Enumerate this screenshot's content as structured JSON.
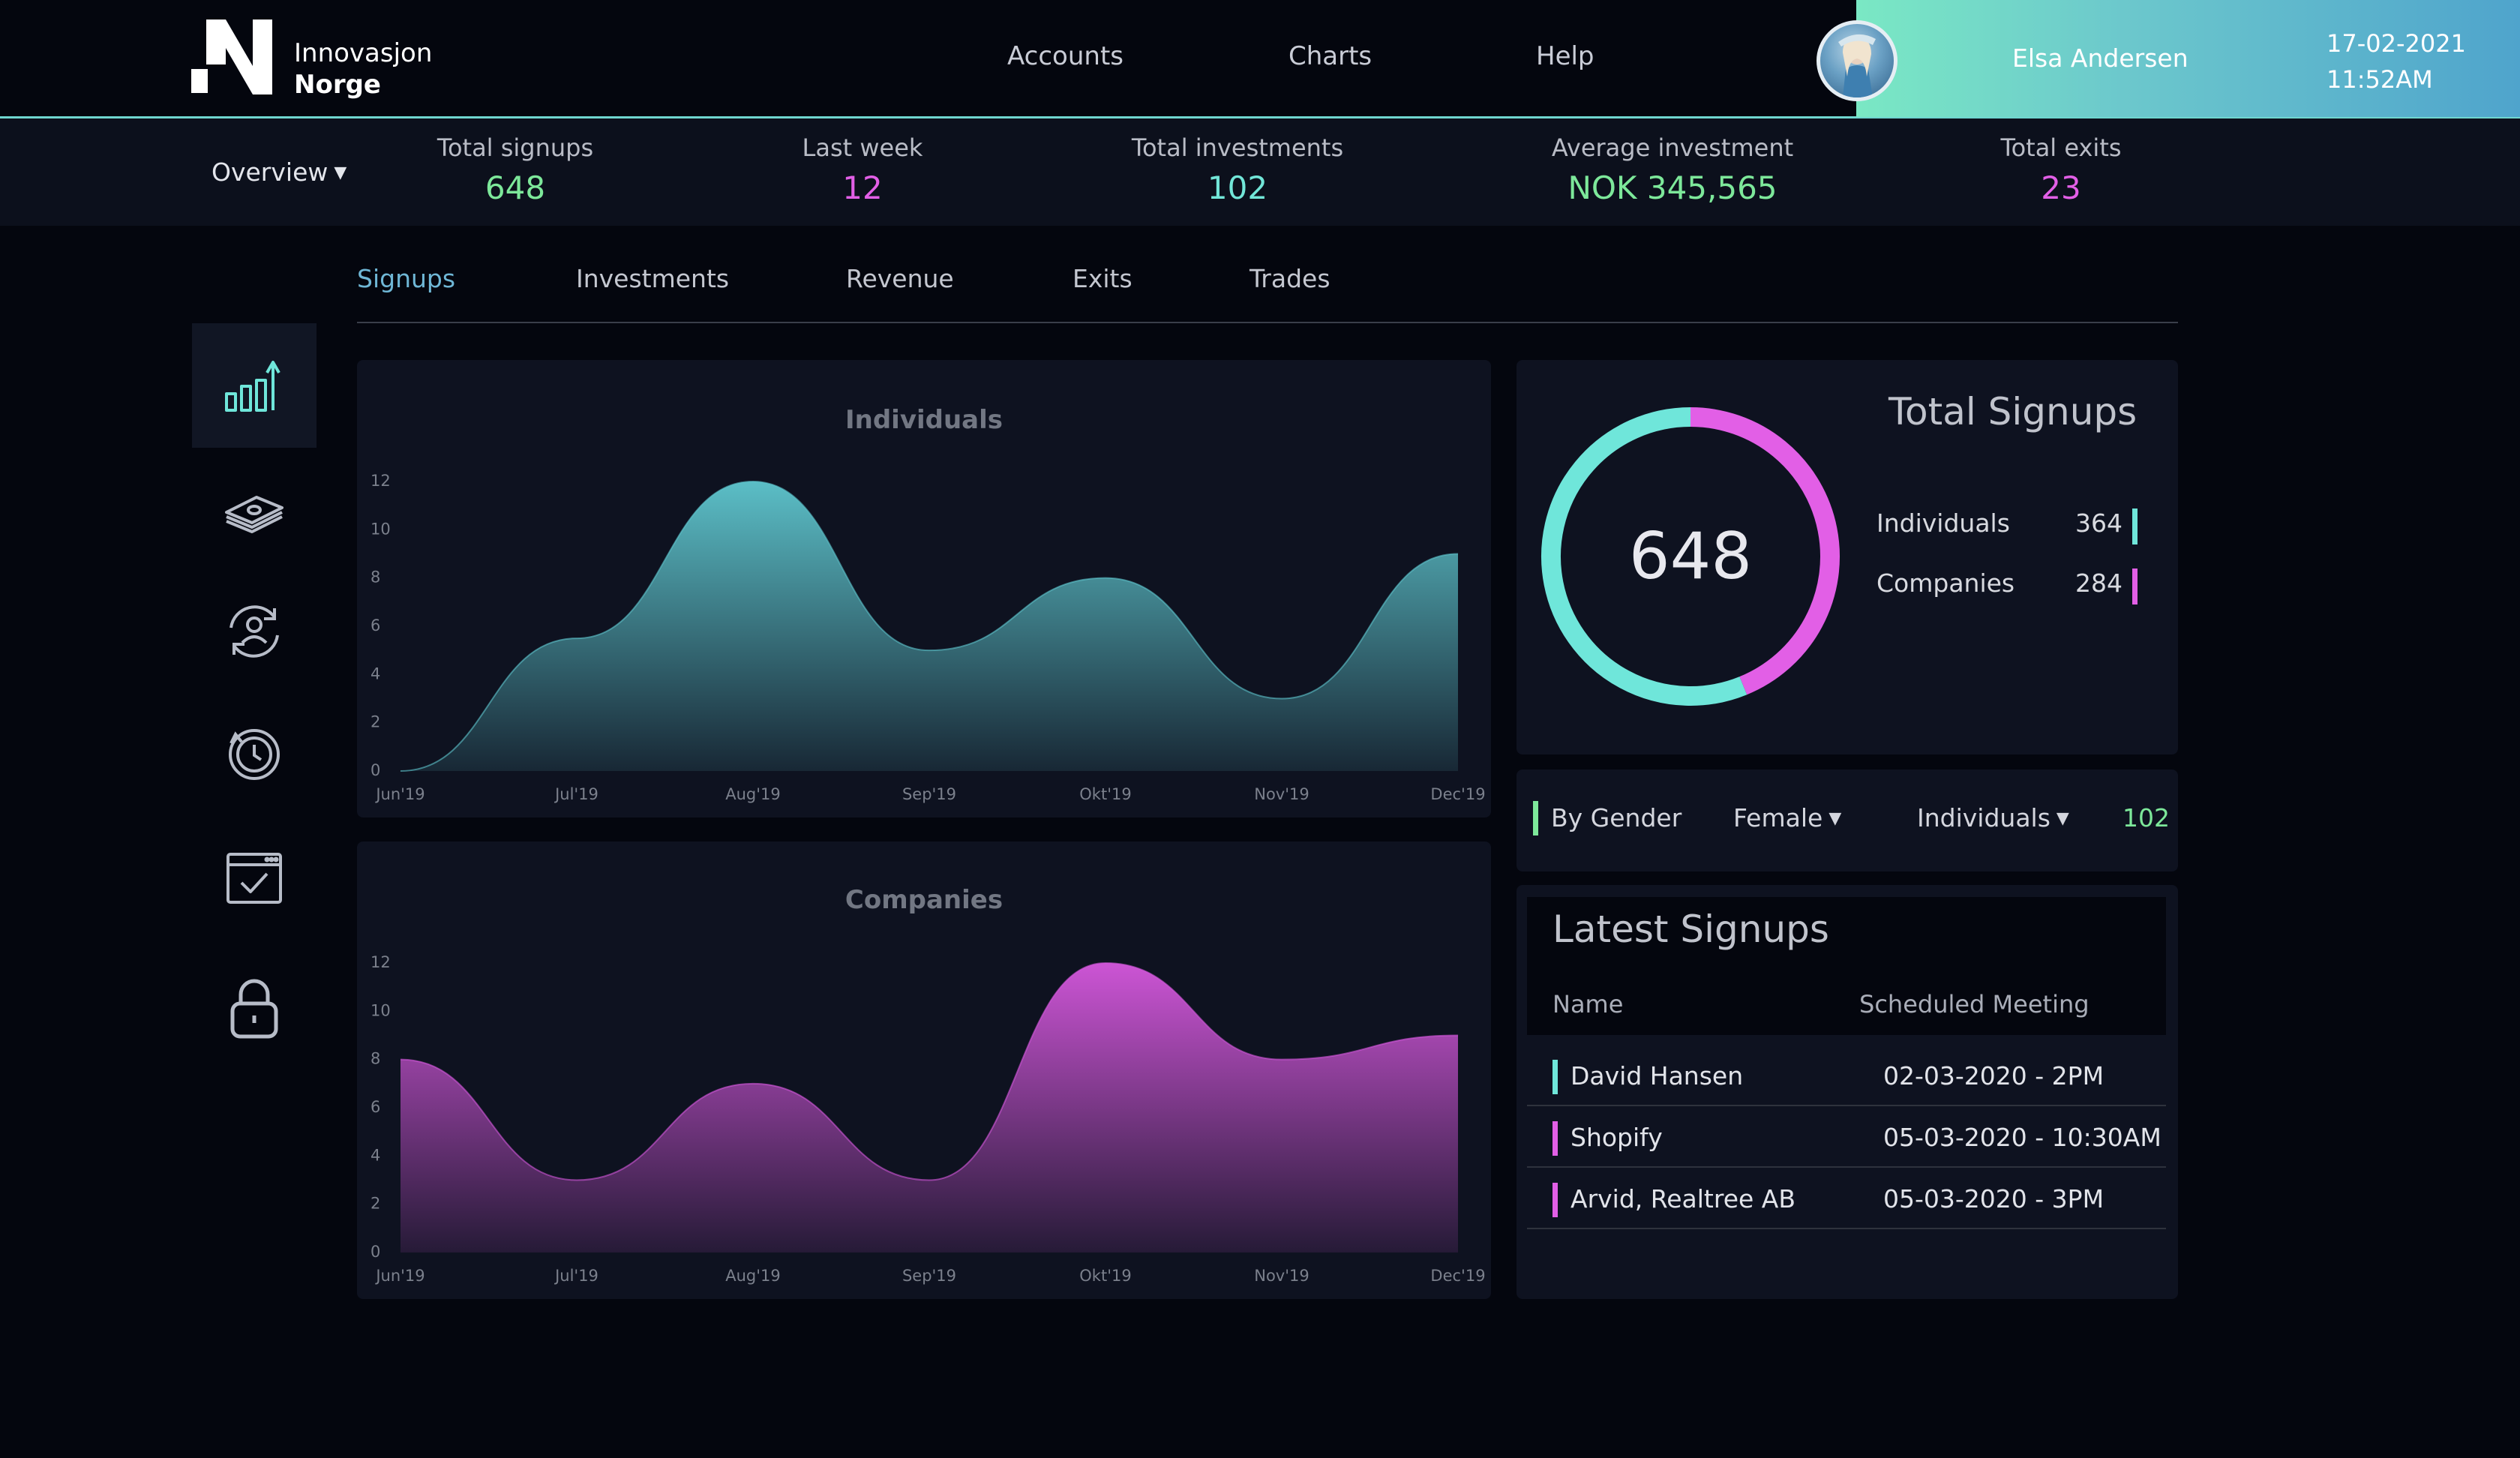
{
  "brand": {
    "line1": "Innovasjon",
    "line2": "Norge"
  },
  "nav": [
    {
      "label": "Accounts"
    },
    {
      "label": "Charts"
    },
    {
      "label": "Help"
    }
  ],
  "user": {
    "name": "Elsa Andersen",
    "date": "17-02-2021",
    "time": "11:52AM"
  },
  "stats": {
    "view_label": "Overview",
    "items": [
      {
        "label": "Total signups",
        "value": "648",
        "color": "#7de89a"
      },
      {
        "label": "Last week",
        "value": "12",
        "color": "#e25fe6"
      },
      {
        "label": "Total investments",
        "value": "102",
        "color": "#72e6d8"
      },
      {
        "label": "Average investment",
        "currency": "NOK",
        "value": "345,565",
        "color": "#7de89a"
      },
      {
        "label": "Total exits",
        "value": "23",
        "color": "#e25fe6"
      }
    ]
  },
  "tabs": [
    {
      "label": "Signups",
      "active": true
    },
    {
      "label": "Investments"
    },
    {
      "label": "Revenue"
    },
    {
      "label": "Exits"
    },
    {
      "label": "Trades"
    }
  ],
  "sidebar": [
    {
      "icon": "bar-chart-growth-icon",
      "active": true
    },
    {
      "icon": "money-stack-icon"
    },
    {
      "icon": "user-exchange-icon"
    },
    {
      "icon": "clock-history-icon"
    },
    {
      "icon": "calendar-check-icon"
    },
    {
      "icon": "lock-icon"
    }
  ],
  "chart_data": [
    {
      "type": "area",
      "title": "Individuals",
      "categories": [
        "Jun'19",
        "Jul'19",
        "Aug'19",
        "Sep'19",
        "Okt'19",
        "Nov'19",
        "Dec'19"
      ],
      "values": [
        0,
        5.5,
        12,
        5,
        8,
        3,
        9
      ],
      "ylim": [
        0,
        12
      ],
      "yticks": [
        0,
        2,
        4,
        6,
        8,
        10,
        12
      ],
      "color": "#5fc7cf"
    },
    {
      "type": "area",
      "title": "Companies",
      "categories": [
        "Jun'19",
        "Jul'19",
        "Aug'19",
        "Sep'19",
        "Okt'19",
        "Nov'19",
        "Dec'19"
      ],
      "values": [
        8,
        3,
        7,
        3,
        12,
        8,
        9
      ],
      "ylim": [
        0,
        12
      ],
      "yticks": [
        0,
        2,
        4,
        6,
        8,
        10,
        12
      ],
      "color": "#d658de"
    },
    {
      "type": "pie",
      "title": "Total Signups",
      "total": "648",
      "series": [
        {
          "name": "Individuals",
          "value": 364,
          "color": "#6fe6da"
        },
        {
          "name": "Companies",
          "value": 284,
          "color": "#e25fe6"
        }
      ]
    }
  ],
  "filter": {
    "label": "By Gender",
    "gender": "Female",
    "type": "Individuals",
    "value": "102"
  },
  "latest": {
    "title": "Latest Signups",
    "col_name": "Name",
    "col_meeting": "Scheduled Meeting",
    "rows": [
      {
        "name": "David Hansen",
        "meeting": "02-03-2020 - 2PM",
        "color": "#6fe6da"
      },
      {
        "name": "Shopify",
        "meeting": "05-03-2020 - 10:30AM",
        "color": "#e25fe6"
      },
      {
        "name": "Arvid, Realtree AB",
        "meeting": "05-03-2020 - 3PM",
        "color": "#e25fe6"
      }
    ]
  }
}
